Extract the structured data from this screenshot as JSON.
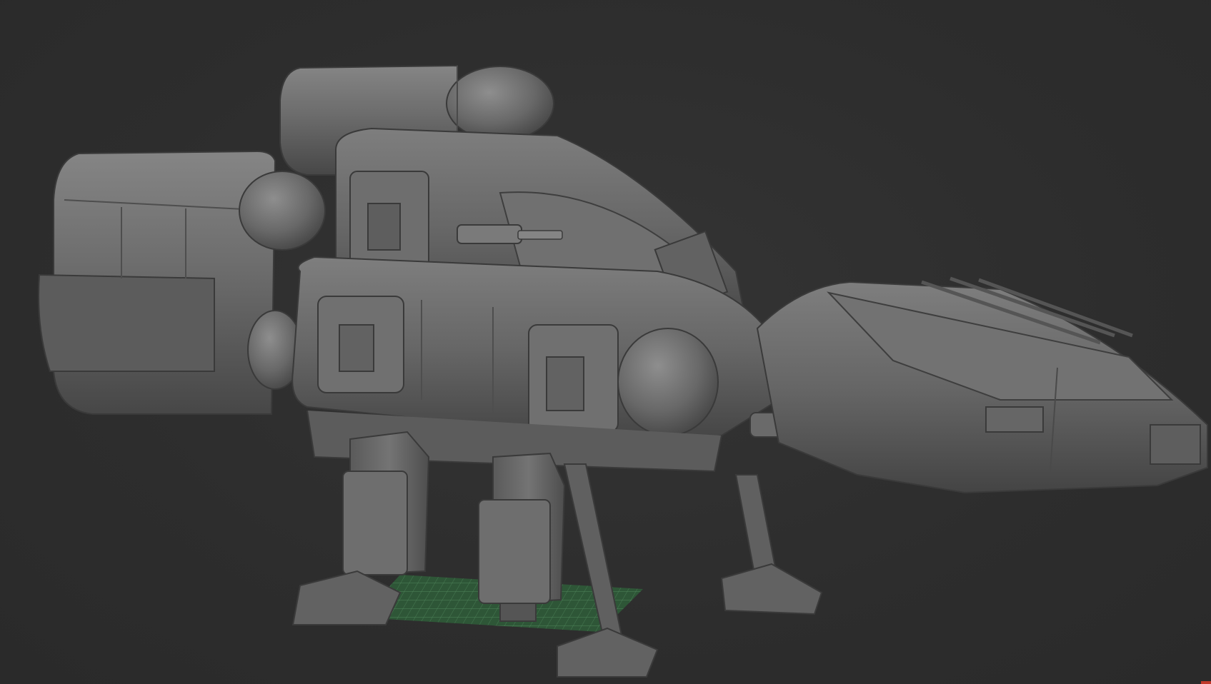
{
  "viewport": {
    "background": "#2e2e2e",
    "model_color": "#6f6f6f",
    "model_shadow": "#3c3c3c",
    "model_highlight": "#8c8c8c",
    "grid_color": "#2e5a38",
    "grid_line_color": "#4f8a5c",
    "corner_mark_color": "#c0392b"
  },
  "model": {
    "name_icon": "mech-walker-model",
    "parts": [
      "rear-upper-tank",
      "rear-lower-tank",
      "main-hull",
      "dorsal-cannon",
      "nose-section",
      "main-cannon",
      "rear-left-leg",
      "rear-right-leg",
      "front-left-leg",
      "front-right-leg"
    ]
  },
  "ground_grid": {
    "visible": true
  }
}
